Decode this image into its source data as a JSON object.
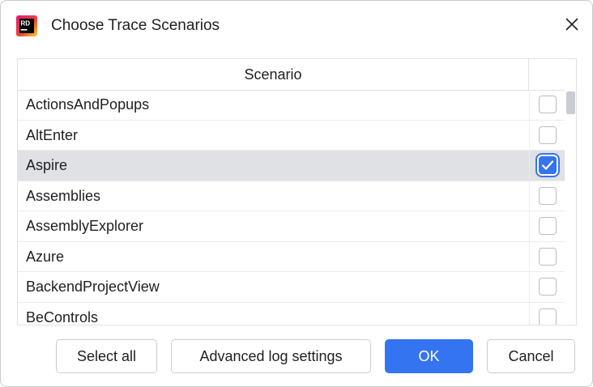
{
  "window": {
    "title": "Choose Trace Scenarios",
    "app_icon_text": "RD",
    "app_icon": "rider-logo-icon",
    "close_icon": "close-icon"
  },
  "table": {
    "columns": [
      "Scenario",
      ""
    ],
    "rows": [
      {
        "label": "ActionsAndPopups",
        "checked": false
      },
      {
        "label": "AltEnter",
        "checked": false
      },
      {
        "label": "Aspire",
        "checked": true,
        "selected": true
      },
      {
        "label": "Assemblies",
        "checked": false
      },
      {
        "label": "AssemblyExplorer",
        "checked": false
      },
      {
        "label": "Azure",
        "checked": false
      },
      {
        "label": "BackendProjectView",
        "checked": false
      },
      {
        "label": "BeControls",
        "checked": false
      }
    ]
  },
  "buttons": {
    "select_all": "Select all",
    "advanced": "Advanced log settings",
    "ok": "OK",
    "cancel": "Cancel"
  },
  "colors": {
    "accent": "#3574f0",
    "selected_row": "#dfe1e5",
    "border": "#c9ccd1"
  }
}
